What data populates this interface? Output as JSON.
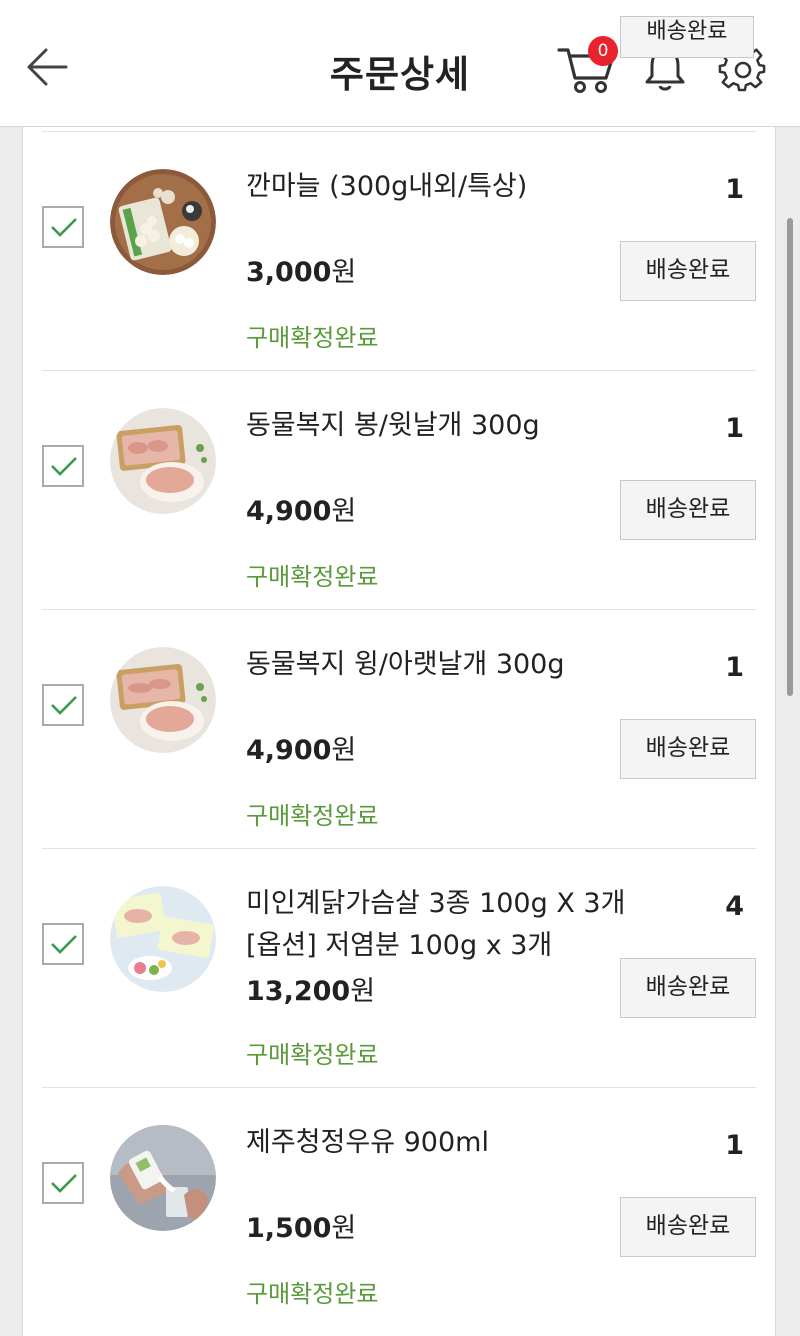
{
  "header": {
    "title": "주문상세",
    "cart_count": "0",
    "floating_tag": "배송완료"
  },
  "items": [
    {
      "name": "깐마늘 (300g내외/특상)",
      "price": "3,000",
      "currency": "원",
      "quantity": "1",
      "status": "구매확정완료",
      "button": "배송완료"
    },
    {
      "name": "동물복지 봉/윗날개 300g",
      "price": "4,900",
      "currency": "원",
      "quantity": "1",
      "status": "구매확정완료",
      "button": "배송완료"
    },
    {
      "name": "동물복지 윙/아랫날개 300g",
      "price": "4,900",
      "currency": "원",
      "quantity": "1",
      "status": "구매확정완료",
      "button": "배송완료"
    },
    {
      "name": "미인계닭가슴살 3종 100g X 3개",
      "option": "[옵션] 저염분 100g x 3개",
      "price": "13,200",
      "currency": "원",
      "quantity": "4",
      "status": "구매확정완료",
      "button": "배송완료"
    },
    {
      "name": "제주청정우유 900ml",
      "price": "1,500",
      "currency": "원",
      "quantity": "1",
      "status": "구매확정완료",
      "button": "배송완료"
    }
  ]
}
